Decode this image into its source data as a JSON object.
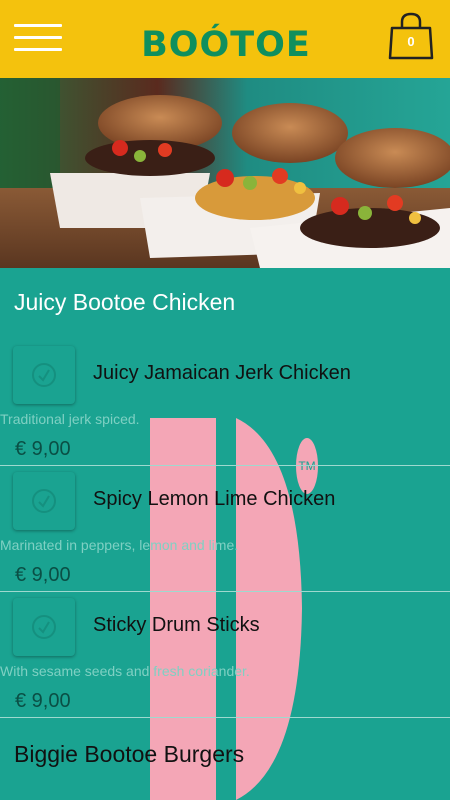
{
  "header": {
    "menu_icon": "hamburger-menu-icon",
    "logo_text": "BOÓTOE",
    "cart_icon": "shopping-bag-icon",
    "cart_count": "0"
  },
  "hero": {
    "image": "burgers-photo"
  },
  "sections": [
    {
      "title": "Juicy Bootoe Chicken",
      "items": [
        {
          "name": "Juicy Jamaican Jerk Chicken",
          "description": "Traditional jerk spiced.",
          "price": "€ 9,00"
        },
        {
          "name": "Spicy Lemon Lime Chicken",
          "description": "Marinated in peppers, lemon and lime.",
          "price": "€ 9,00"
        },
        {
          "name": "Sticky Drum Sticks",
          "description": "With sesame seeds and fresh coriander.",
          "price": "€ 9,00"
        }
      ]
    },
    {
      "title": "Biggie Bootoe Burgers"
    }
  ],
  "colors": {
    "header": "#f4c20d",
    "background": "#1aa391",
    "logo": "#0f8f5e",
    "watermark": "#f4a6b6"
  }
}
